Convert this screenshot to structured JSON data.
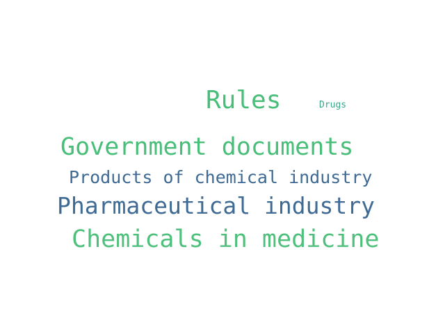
{
  "palette": {
    "green": "#48be79",
    "green_light": "#4fc07c",
    "blue": "#3f6a94",
    "teal": "#3aa58a"
  },
  "words": [
    {
      "text": "Rules",
      "color": "#48be79"
    },
    {
      "text": "Drugs",
      "color": "#3aa58a"
    },
    {
      "text": "Government documents",
      "color": "#48be79"
    },
    {
      "text": "Products of chemical industry",
      "color": "#3f6a94"
    },
    {
      "text": "Pharmaceutical industry",
      "color": "#3f6a94"
    },
    {
      "text": "Chemicals in medicine",
      "color": "#4fc07c"
    }
  ]
}
